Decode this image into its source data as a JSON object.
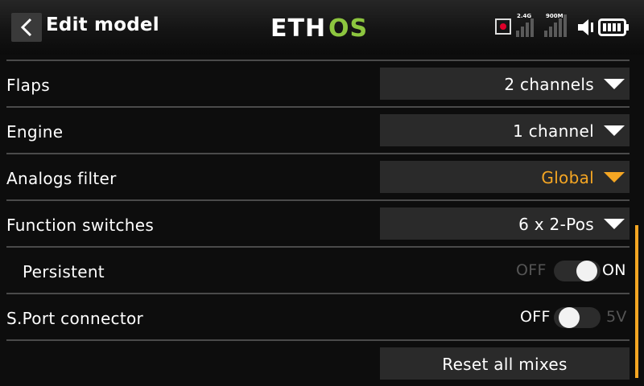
{
  "header": {
    "title": "Edit model",
    "logo_text": "ETHOS",
    "logo_colors": {
      "eth": "#ffffff",
      "os": "#8dc63f"
    },
    "signal_24": "2.4G",
    "signal_900": "900M",
    "icons": [
      "back-chevron-icon",
      "record-icon",
      "signal-bars-icon",
      "speaker-icon",
      "battery-icon"
    ]
  },
  "rows": {
    "flaps": {
      "label": "Flaps",
      "value": "2 channels"
    },
    "engine": {
      "label": "Engine",
      "value": "1 channel"
    },
    "analogs": {
      "label": "Analogs filter",
      "value": "Global"
    },
    "fswitch": {
      "label": "Function switches",
      "value": "6 x 2-Pos"
    },
    "persistent": {
      "label": "Persistent",
      "off": "OFF",
      "on": "ON",
      "state": "on"
    },
    "sport": {
      "label": "S.Port connector",
      "off": "OFF",
      "on": "5V",
      "state": "off"
    },
    "reset": {
      "label": "Reset all mixes"
    }
  },
  "colors": {
    "accent": "#f5a623",
    "background": "#0d0d0d",
    "control": "#2a2a2a",
    "separator": "#4a4a4a"
  }
}
